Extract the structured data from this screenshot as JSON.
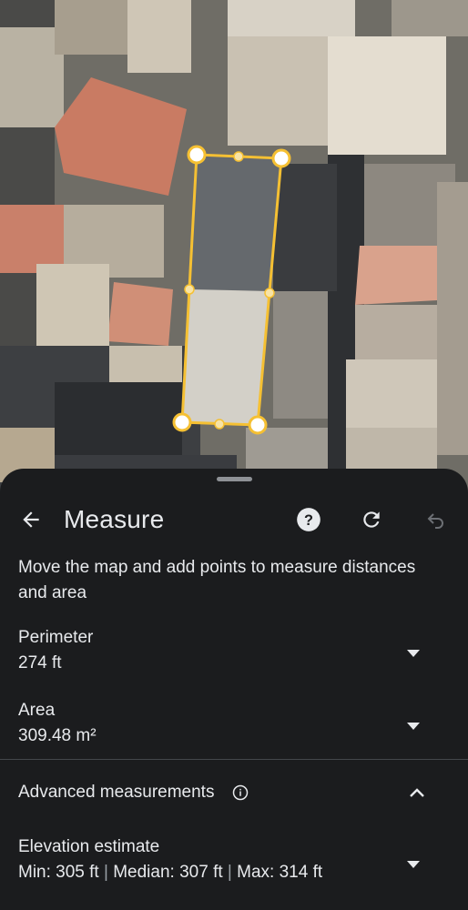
{
  "map": {
    "kind": "satellite",
    "measurement_shape": "polygon",
    "accent_color": "#f5c033"
  },
  "panel": {
    "title": "Measure",
    "icons": {
      "back": "arrow-back-icon",
      "help": "help-circle-icon",
      "reset": "refresh-icon",
      "undo": "undo-icon"
    },
    "description": "Move the map and add points to measure distances and area",
    "perimeter": {
      "label": "Perimeter",
      "value": "274 ft"
    },
    "area": {
      "label": "Area",
      "value": "309.48 m²"
    },
    "advanced": {
      "label": "Advanced measurements",
      "expanded": true
    },
    "elevation": {
      "label": "Elevation estimate",
      "min": "Min: 305 ft",
      "median": "Median: 307 ft",
      "max": "Max: 314 ft",
      "separator": "|"
    }
  }
}
